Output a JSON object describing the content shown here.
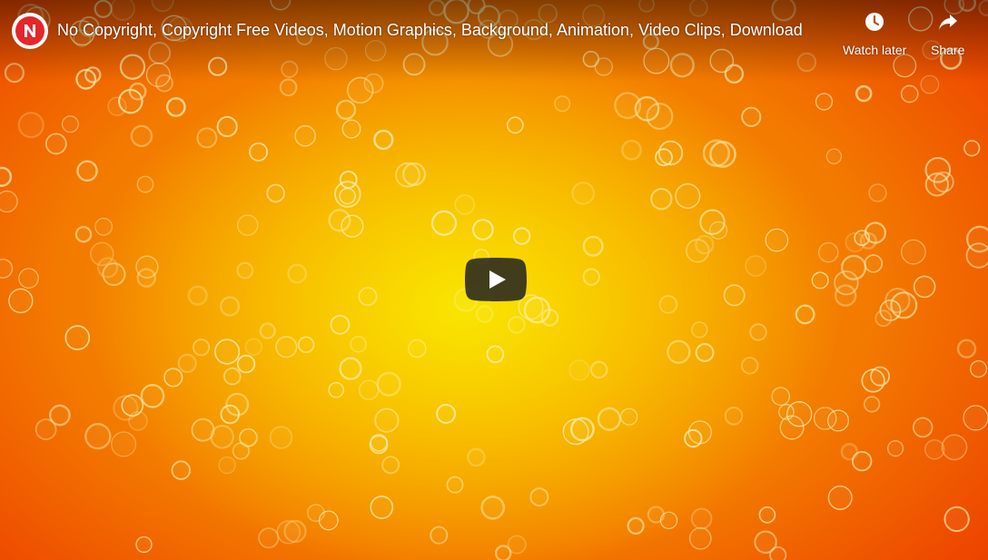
{
  "header": {
    "title": "No Copyright, Copyright Free Videos, Motion Graphics, Background, Animation, Video Clips, Download",
    "channel_logo_icon": "n-logo-icon"
  },
  "controls": {
    "watch_later": {
      "label": "Watch later",
      "icon": "clock-icon"
    },
    "share": {
      "label": "Share",
      "icon": "share-arrow-icon"
    }
  },
  "player": {
    "play_icon": "play-icon",
    "colors": {
      "center": "#f9e600",
      "mid": "#f7a000",
      "edge": "#e83800",
      "play_button_bg": "#3a3a3a",
      "logo_red": "#e5262a"
    }
  }
}
